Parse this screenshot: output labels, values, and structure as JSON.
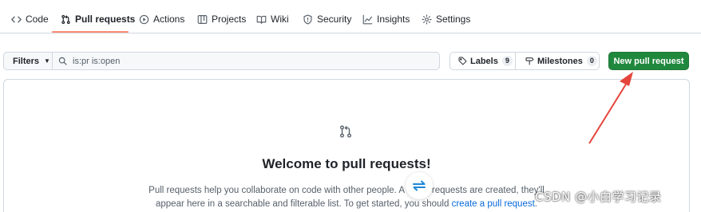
{
  "nav": {
    "tabs": [
      {
        "label": "Code",
        "icon": "code-icon"
      },
      {
        "label": "Pull requests",
        "icon": "git-pull-request-icon",
        "selected": true
      },
      {
        "label": "Actions",
        "icon": "play-icon"
      },
      {
        "label": "Projects",
        "icon": "table-icon"
      },
      {
        "label": "Wiki",
        "icon": "book-icon"
      },
      {
        "label": "Security",
        "icon": "shield-icon"
      },
      {
        "label": "Insights",
        "icon": "graph-icon"
      },
      {
        "label": "Settings",
        "icon": "gear-icon"
      }
    ],
    "selected_color": "#fd8c73"
  },
  "toolbar": {
    "filters_label": "Filters",
    "search_value": "is:pr is:open",
    "labels_label": "Labels",
    "labels_count": "9",
    "milestones_label": "Milestones",
    "milestones_count": "0",
    "new_pr_label": "New pull request",
    "new_pr_color": "#1f883d"
  },
  "blankslate": {
    "title": "Welcome to pull requests!",
    "line1": "Pull requests help you collaborate on code with other people. A",
    "line1_tail": "requests are created, they'll",
    "line2": "appear here in a searchable and filterable list. To get started, you should",
    "link": "create a pull request",
    "line2_end": "."
  },
  "annotation": {
    "arrow_color": "#e5453c"
  },
  "watermark": "CSDN @小白学习记录"
}
